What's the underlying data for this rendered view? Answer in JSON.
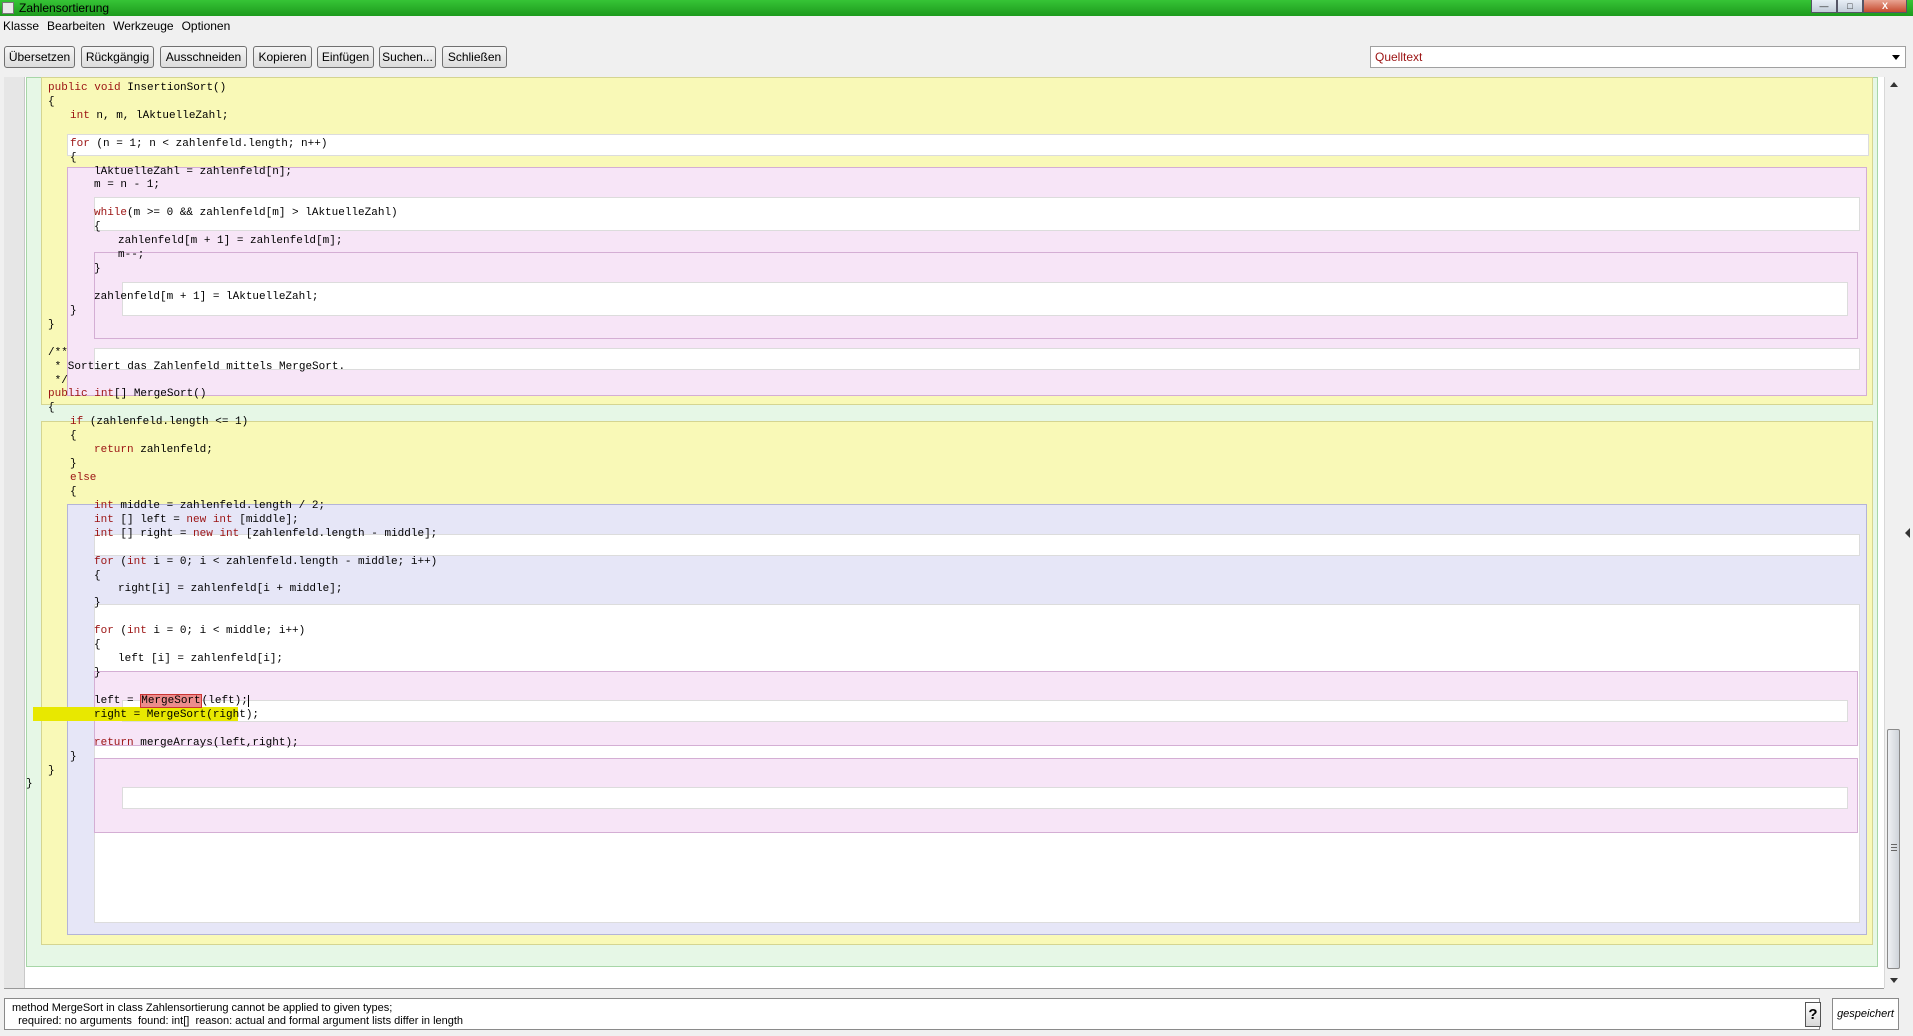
{
  "window": {
    "title": "Zahlensortierung",
    "buttons": {
      "minimize": "—",
      "maximize": "□",
      "close": "X"
    }
  },
  "menu": [
    "Klasse",
    "Bearbeiten",
    "Werkzeuge",
    "Optionen"
  ],
  "toolbar": {
    "buttons": [
      "Übersetzen",
      "Rückgängig",
      "Ausschneiden",
      "Kopieren",
      "Einfügen",
      "Suchen...",
      "Schließen"
    ],
    "view_select": "Quelltext"
  },
  "code": [
    {
      "indent": 1,
      "tokens": [
        {
          "t": " */"
        }
      ]
    },
    {
      "indent": 1,
      "tokens": [
        {
          "t": "public ",
          "c": "kw"
        },
        {
          "t": "void ",
          "c": "kw"
        },
        {
          "t": "InsertionSort()"
        }
      ]
    },
    {
      "indent": 1,
      "tokens": [
        {
          "t": "{"
        }
      ]
    },
    {
      "indent": 2,
      "tokens": [
        {
          "t": "int ",
          "c": "kw"
        },
        {
          "t": "n, m, lAktuelleZahl;"
        }
      ]
    },
    {
      "indent": 2,
      "tokens": []
    },
    {
      "indent": 2,
      "tokens": [
        {
          "t": "for ",
          "c": "kw"
        },
        {
          "t": "(n = 1; n < zahlenfeld.length; n++)"
        }
      ]
    },
    {
      "indent": 2,
      "tokens": [
        {
          "t": "{"
        }
      ]
    },
    {
      "indent": 3,
      "tokens": [
        {
          "t": "lAktuelleZahl = zahlenfeld[n];"
        }
      ]
    },
    {
      "indent": 3,
      "tokens": [
        {
          "t": "m = n - 1;"
        }
      ]
    },
    {
      "indent": 3,
      "tokens": []
    },
    {
      "indent": 3,
      "tokens": [
        {
          "t": "while",
          "c": "kw"
        },
        {
          "t": "(m >= 0 && zahlenfeld[m] > lAktuelleZahl)"
        }
      ]
    },
    {
      "indent": 3,
      "tokens": [
        {
          "t": "{"
        }
      ]
    },
    {
      "indent": 4,
      "tokens": [
        {
          "t": "zahlenfeld[m + 1] = zahlenfeld[m];"
        }
      ]
    },
    {
      "indent": 4,
      "tokens": [
        {
          "t": "m--;"
        }
      ]
    },
    {
      "indent": 3,
      "tokens": [
        {
          "t": "}"
        }
      ]
    },
    {
      "indent": 3,
      "tokens": []
    },
    {
      "indent": 3,
      "tokens": [
        {
          "t": "zahlenfeld[m + 1] = lAktuelleZahl;"
        }
      ]
    },
    {
      "indent": 2,
      "tokens": [
        {
          "t": "}"
        }
      ]
    },
    {
      "indent": 1,
      "tokens": [
        {
          "t": "}"
        }
      ]
    },
    {
      "indent": 1,
      "tokens": []
    },
    {
      "indent": 1,
      "tokens": [
        {
          "t": "/**"
        }
      ]
    },
    {
      "indent": 1,
      "tokens": [
        {
          "t": " * Sortiert das Zahlenfeld mittels MergeSort."
        }
      ]
    },
    {
      "indent": 1,
      "tokens": [
        {
          "t": " */"
        }
      ]
    },
    {
      "indent": 1,
      "tokens": [
        {
          "t": "public ",
          "c": "kw"
        },
        {
          "t": "int",
          "c": "kw"
        },
        {
          "t": "[] MergeSort()"
        }
      ]
    },
    {
      "indent": 1,
      "tokens": [
        {
          "t": "{"
        }
      ]
    },
    {
      "indent": 2,
      "tokens": [
        {
          "t": "if ",
          "c": "kw"
        },
        {
          "t": "(zahlenfeld.length <= 1)"
        }
      ]
    },
    {
      "indent": 2,
      "tokens": [
        {
          "t": "{"
        }
      ]
    },
    {
      "indent": 3,
      "tokens": [
        {
          "t": "return ",
          "c": "kw"
        },
        {
          "t": "zahlenfeld;"
        }
      ]
    },
    {
      "indent": 2,
      "tokens": [
        {
          "t": "}"
        }
      ]
    },
    {
      "indent": 2,
      "tokens": [
        {
          "t": "else",
          "c": "kw"
        }
      ]
    },
    {
      "indent": 2,
      "tokens": [
        {
          "t": "{"
        }
      ]
    },
    {
      "indent": 3,
      "tokens": [
        {
          "t": "int ",
          "c": "kw"
        },
        {
          "t": "middle = zahlenfeld.length / 2;"
        }
      ]
    },
    {
      "indent": 3,
      "tokens": [
        {
          "t": "int ",
          "c": "kw"
        },
        {
          "t": "[] left = "
        },
        {
          "t": "new ",
          "c": "kw"
        },
        {
          "t": "int ",
          "c": "kw"
        },
        {
          "t": "[middle];"
        }
      ]
    },
    {
      "indent": 3,
      "tokens": [
        {
          "t": "int ",
          "c": "kw"
        },
        {
          "t": "[] right = "
        },
        {
          "t": "new ",
          "c": "kw"
        },
        {
          "t": "int ",
          "c": "kw"
        },
        {
          "t": "[zahlenfeld.length - middle];"
        }
      ]
    },
    {
      "indent": 3,
      "tokens": []
    },
    {
      "indent": 3,
      "tokens": [
        {
          "t": "for ",
          "c": "kw"
        },
        {
          "t": "("
        },
        {
          "t": "int ",
          "c": "kw"
        },
        {
          "t": "i = 0; i < zahlenfeld.length - middle; i++)"
        }
      ]
    },
    {
      "indent": 3,
      "tokens": [
        {
          "t": "{"
        }
      ]
    },
    {
      "indent": 4,
      "tokens": [
        {
          "t": "right[i] = zahlenfeld[i + middle];"
        }
      ]
    },
    {
      "indent": 3,
      "tokens": [
        {
          "t": "}"
        }
      ]
    },
    {
      "indent": 3,
      "tokens": []
    },
    {
      "indent": 3,
      "tokens": [
        {
          "t": "for ",
          "c": "kw"
        },
        {
          "t": "("
        },
        {
          "t": "int ",
          "c": "kw"
        },
        {
          "t": "i = 0; i < middle; i++)"
        }
      ]
    },
    {
      "indent": 3,
      "tokens": [
        {
          "t": "{"
        }
      ]
    },
    {
      "indent": 4,
      "tokens": [
        {
          "t": "left [i] = zahlenfeld[i];"
        }
      ]
    },
    {
      "indent": 3,
      "tokens": [
        {
          "t": "}"
        }
      ]
    },
    {
      "indent": 3,
      "tokens": []
    },
    {
      "indent": 3,
      "tokens": [
        {
          "t": "left = "
        },
        {
          "t": "MergeSort",
          "c": "err"
        },
        {
          "t": "(left);",
          "c": "cursor"
        }
      ]
    },
    {
      "indent": 3,
      "tokens": [
        {
          "t": "right = MergeSort(right);"
        }
      ]
    },
    {
      "indent": 3,
      "tokens": []
    },
    {
      "indent": 3,
      "tokens": [
        {
          "t": "return ",
          "c": "kw"
        },
        {
          "t": "mergeArrays(left,right);"
        }
      ]
    },
    {
      "indent": 2,
      "tokens": [
        {
          "t": "}"
        }
      ]
    },
    {
      "indent": 1,
      "tokens": [
        {
          "t": "}"
        }
      ]
    },
    {
      "indent": 0,
      "tokens": [
        {
          "t": "}"
        }
      ]
    }
  ],
  "colors": {
    "keyword": "#9b1212",
    "class_scope": "#e6f7e6",
    "method_scope": "#f9f9b7",
    "loop_scope": "#f7e5f7",
    "if_scope": "#e6e6f7",
    "current_line": "#e8e800",
    "error_mark": "#ec8c8c",
    "title_bar": "#1d9a1d"
  },
  "status": {
    "message_line1": "method MergeSort in class Zahlensortierung cannot be applied to given types;",
    "message_line2": "  required: no arguments  found: int[]  reason: actual and formal argument lists differ in length",
    "help_label": "?",
    "saved_label": "gespeichert"
  }
}
